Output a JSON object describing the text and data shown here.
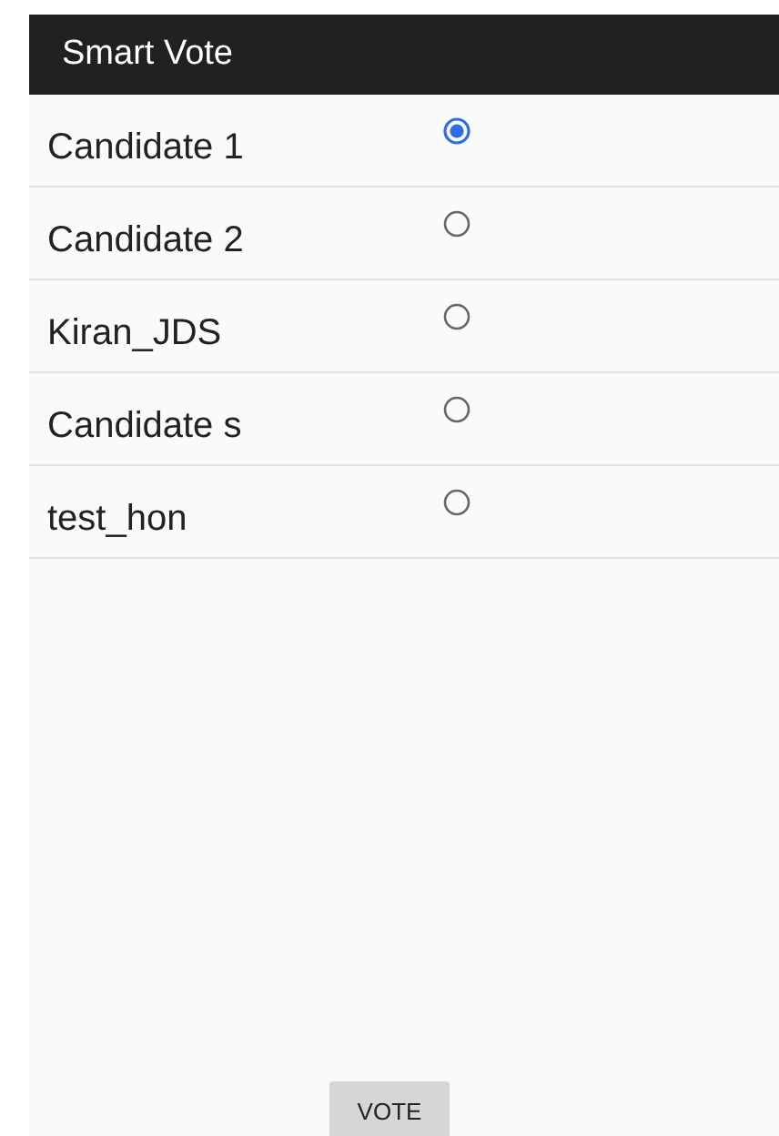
{
  "app_bar": {
    "title": "Smart Vote"
  },
  "candidates": [
    {
      "name": "Candidate 1",
      "selected": true
    },
    {
      "name": "Candidate 2",
      "selected": false
    },
    {
      "name": "Kiran_JDS",
      "selected": false
    },
    {
      "name": "Candidate s",
      "selected": false
    },
    {
      "name": "test_hon",
      "selected": false
    }
  ],
  "vote_button": {
    "label": "VOTE"
  }
}
